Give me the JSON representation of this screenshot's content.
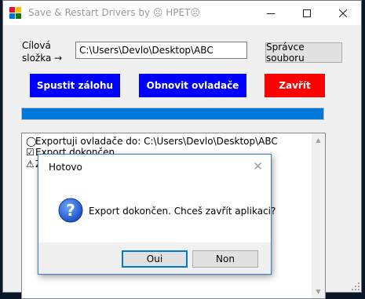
{
  "window": {
    "title": "Save & Restart Drivers by ☹ HPET☹"
  },
  "form": {
    "target_label_line1": "Cílová",
    "target_label_line2": "složka →",
    "path_value": "C:\\Users\\Devlo\\Desktop\\ABC",
    "browse_label": "Správce souboru"
  },
  "actions": {
    "backup_label": "Spustit zálohu",
    "restore_label": "Obnovit ovladače",
    "close_label": "Zavřít"
  },
  "progress": {
    "value": 1.0,
    "color": "#0078d7"
  },
  "log": {
    "lines": [
      {
        "symbol": "◯",
        "text": "Exportuji ovladače do: C:\\Users\\Devlo\\Desktop\\ABC"
      },
      {
        "symbol": "☑",
        "text": "Export dokončen."
      },
      {
        "symbol": "⚠",
        "text": "Z"
      }
    ]
  },
  "dialog": {
    "title": "Hotovo",
    "message": "Export dokončen. Chceš zavřít aplikaci?",
    "yes_label": "Oui",
    "no_label": "Non",
    "icon": "question-icon"
  },
  "colors": {
    "action_blue": "#0000ff",
    "action_red": "#ff0000"
  }
}
